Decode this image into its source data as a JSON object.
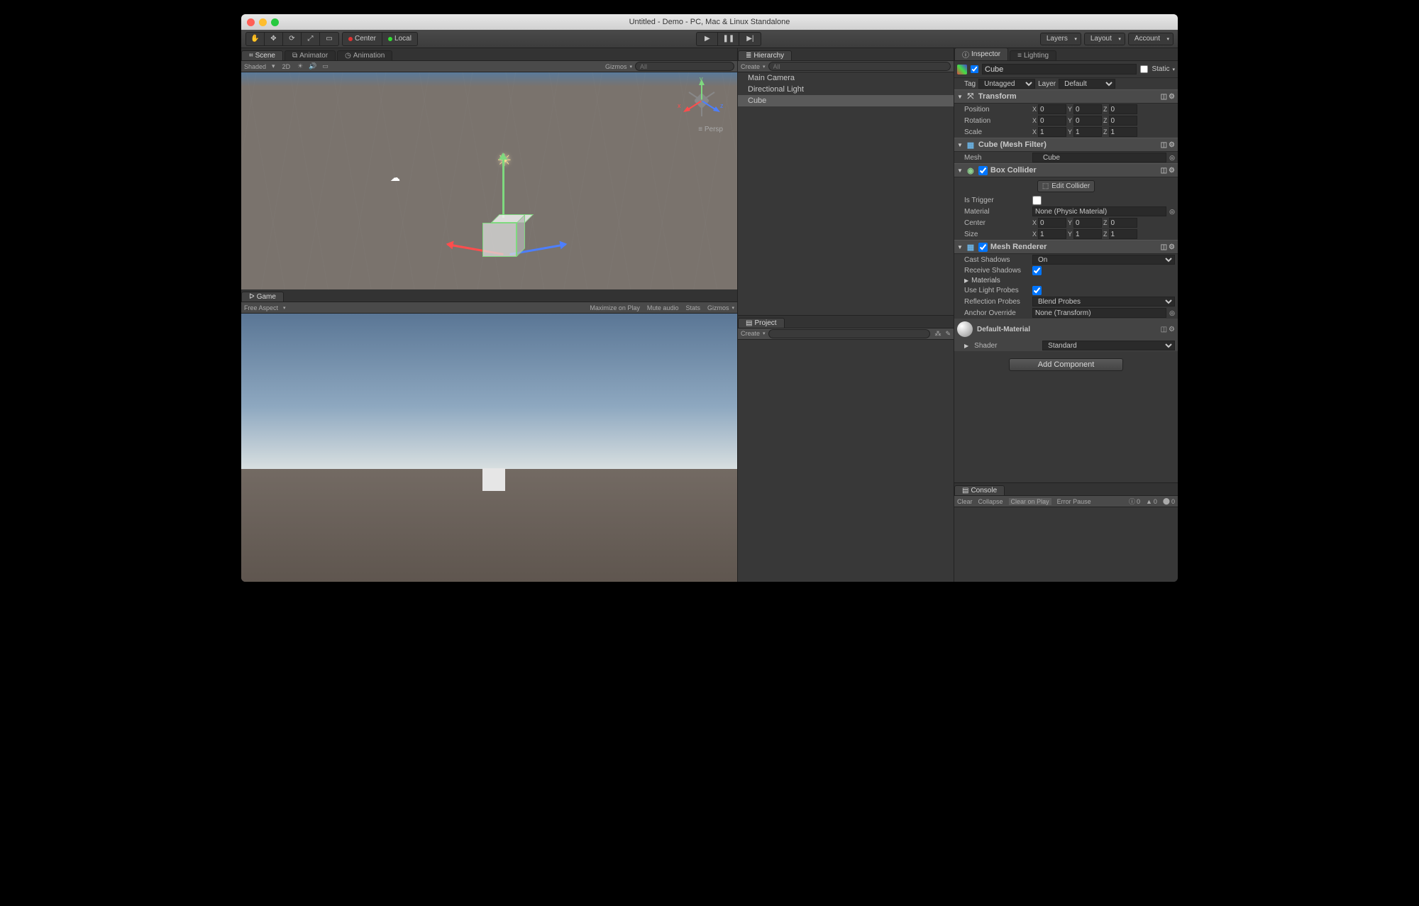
{
  "window": {
    "title": "Untitled - Demo - PC, Mac & Linux Standalone"
  },
  "toolbar": {
    "pivot_center": "Center",
    "pivot_local": "Local",
    "layers": "Layers",
    "layout": "Layout",
    "account": "Account"
  },
  "tabs": {
    "scene": "Scene",
    "animator": "Animator",
    "animation": "Animation",
    "game": "Game",
    "hierarchy": "Hierarchy",
    "project": "Project",
    "inspector": "Inspector",
    "lighting": "Lighting",
    "console": "Console"
  },
  "scene_toolbar": {
    "shaded": "Shaded",
    "twod": "2D",
    "gizmos": "Gizmos",
    "search_placeholder": "All"
  },
  "scene_view": {
    "persp": "Persp",
    "x": "x",
    "y": "y",
    "z": "z"
  },
  "game_toolbar": {
    "aspect": "Free Aspect",
    "maximize": "Maximize on Play",
    "mute": "Mute audio",
    "stats": "Stats",
    "gizmos": "Gizmos"
  },
  "hierarchy": {
    "create": "Create",
    "search_placeholder": "All",
    "items": [
      "Main Camera",
      "Directional Light",
      "Cube"
    ]
  },
  "project": {
    "create": "Create",
    "search_placeholder": ""
  },
  "inspector": {
    "object_name": "Cube",
    "static": "Static",
    "tag_label": "Tag",
    "tag_value": "Untagged",
    "layer_label": "Layer",
    "layer_value": "Default",
    "transform": {
      "title": "Transform",
      "position": "Position",
      "rotation": "Rotation",
      "scale": "Scale",
      "px": "0",
      "py": "0",
      "pz": "0",
      "rx": "0",
      "ry": "0",
      "rz": "0",
      "sx": "1",
      "sy": "1",
      "sz": "1"
    },
    "mesh_filter": {
      "title": "Cube (Mesh Filter)",
      "mesh_label": "Mesh",
      "mesh_value": "Cube"
    },
    "box_collider": {
      "title": "Box Collider",
      "edit": "Edit Collider",
      "is_trigger": "Is Trigger",
      "material_label": "Material",
      "material_value": "None (Physic Material)",
      "center": "Center",
      "cx": "0",
      "cy": "0",
      "cz": "0",
      "size": "Size",
      "sx": "1",
      "sy": "1",
      "sz": "1"
    },
    "mesh_renderer": {
      "title": "Mesh Renderer",
      "cast": "Cast Shadows",
      "cast_val": "On",
      "receive": "Receive Shadows",
      "materials": "Materials",
      "probes": "Use Light Probes",
      "reflection": "Reflection Probes",
      "reflection_val": "Blend Probes",
      "anchor": "Anchor Override",
      "anchor_val": "None (Transform)"
    },
    "material": {
      "name": "Default-Material",
      "shader_label": "Shader",
      "shader_value": "Standard"
    },
    "add_component": "Add Component"
  },
  "console": {
    "clear": "Clear",
    "collapse": "Collapse",
    "clear_on_play": "Clear on Play",
    "error_pause": "Error Pause",
    "info_count": "0",
    "warn_count": "0",
    "err_count": "0"
  }
}
